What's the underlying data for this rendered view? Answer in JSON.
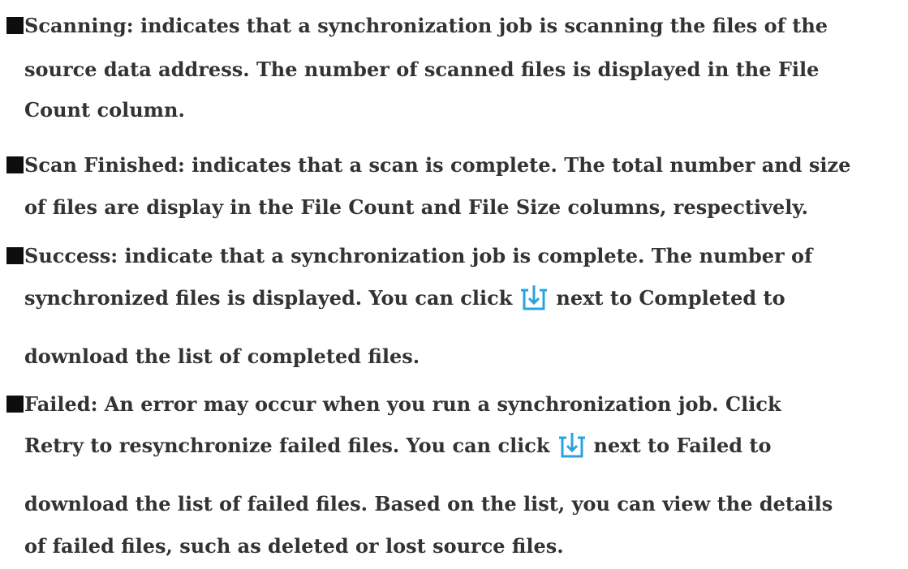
{
  "colors": {
    "text": "#333333",
    "bullet": "#0d0d0d",
    "icon": "#29a3e0"
  },
  "items": [
    {
      "bullet_icon": "square-bullet-icon",
      "lines": [
        "Scanning: indicates that a synchronization job is scanning the files of the",
        " source data address. The number of scanned files is displayed in the File",
        "Count column."
      ]
    },
    {
      "bullet_icon": "square-bullet-icon",
      "lines": [
        "Scan Finished: indicates that a scan is complete. The total number and size",
        "of files are display in the File Count and File Size columns, respectively."
      ]
    },
    {
      "bullet_icon": "square-bullet-icon",
      "lines": [
        "Success: indicate that a synchronization job is complete. The number of"
      ],
      "icon_line": {
        "before": "synchronized files is displayed. You can click",
        "icon": "download-icon",
        "after": "next to Completed to"
      },
      "tail": "download the list of completed files."
    },
    {
      "bullet_icon": "square-bullet-icon",
      "lines": [
        "Failed: An error may occur when you run a synchronization job. Click"
      ],
      "icon_line": {
        "before": "Retry to resynchronize failed files. You can click",
        "icon": "download-icon",
        "after": "next to Failed to"
      },
      "tail_lines": [
        "download the list of failed files. Based on the list, you can view the details",
        "of failed files, such as deleted or lost source files."
      ]
    }
  ]
}
